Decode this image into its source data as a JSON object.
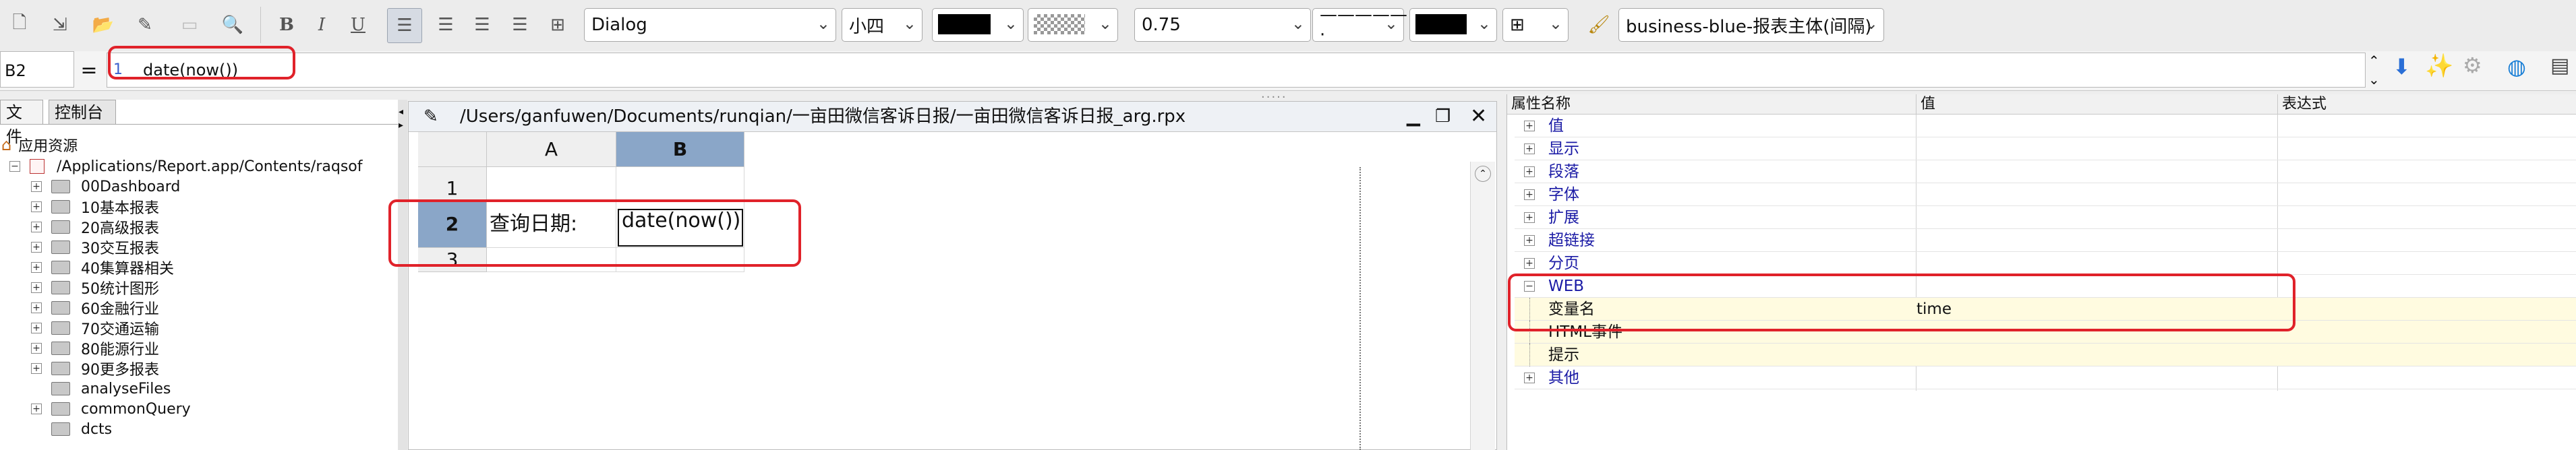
{
  "toolbar": {
    "font_name": "Dialog",
    "font_size": "小四",
    "line_width": "0.75",
    "style_name": "business-blue-报表主体(间隔)",
    "bold": "B",
    "italic": "I",
    "underline": "U",
    "line_style": "—————·"
  },
  "formula_bar": {
    "cell_ref": "B2",
    "equals": "=",
    "line_number": "1",
    "formula": "date(now())"
  },
  "left_panel": {
    "tabs": [
      "文件",
      "控制台"
    ],
    "root_label": "应用资源",
    "path_label": "/Applications/Report.app/Contents/raqsof",
    "items": [
      "00Dashboard",
      "10基本报表",
      "20高级报表",
      "30交互报表",
      "40集算器相关",
      "50统计图形",
      "60金融行业",
      "70交通运输",
      "80能源行业",
      "90更多报表",
      "analyseFiles",
      "commonQuery",
      "dcts"
    ]
  },
  "editor": {
    "title": "/Users/ganfuwen/Documents/runqian/一亩田微信客诉日报/一亩田微信客诉日报_arg.rpx",
    "columns": [
      "A",
      "B"
    ],
    "rows": [
      "1",
      "2",
      "3"
    ],
    "cell_a2": "查询日期:",
    "cell_b2": "date(now())"
  },
  "properties": {
    "headers": [
      "属性名称",
      "值",
      "表达式"
    ],
    "groups": [
      "值",
      "显示",
      "段落",
      "字体",
      "扩展",
      "超链接",
      "分页",
      "WEB"
    ],
    "web_children": [
      {
        "name": "变量名",
        "value": "time"
      },
      {
        "name": "HTML事件",
        "value": ""
      },
      {
        "name": "提示",
        "value": ""
      }
    ],
    "last_group": "其他"
  },
  "colors": {
    "highlight_red": "#e0222a",
    "header_selected": "#8aa6c8",
    "property_text": "#1a1aa5",
    "yellow_row": "#fffbe0"
  }
}
